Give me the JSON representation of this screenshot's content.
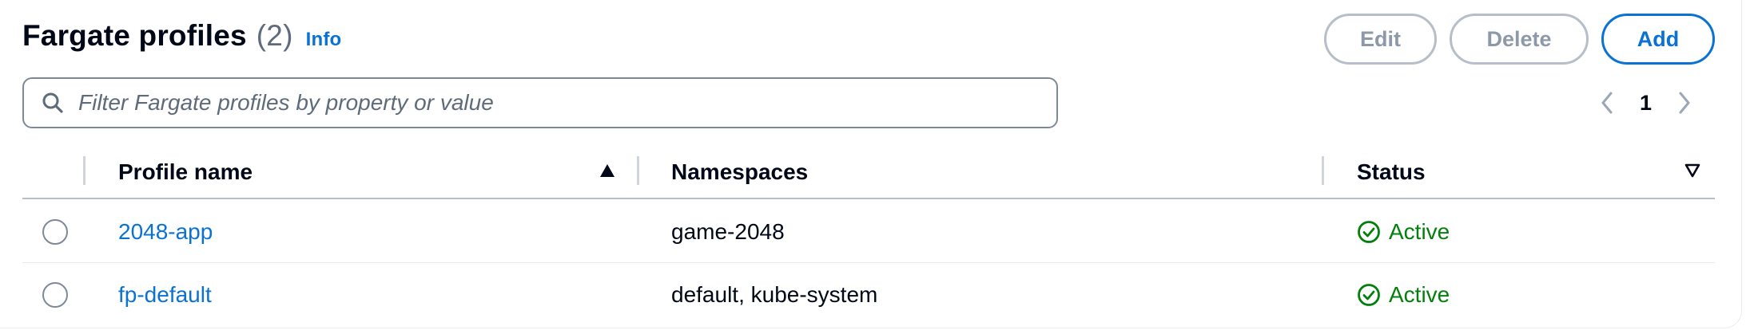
{
  "header": {
    "title": "Fargate profiles",
    "count": "(2)",
    "info_label": "Info"
  },
  "actions": {
    "edit_label": "Edit",
    "delete_label": "Delete",
    "add_label": "Add"
  },
  "search": {
    "placeholder": "Filter Fargate profiles by property or value"
  },
  "pagination": {
    "current_page": "1"
  },
  "table": {
    "columns": {
      "profile_name": "Profile name",
      "namespaces": "Namespaces",
      "status": "Status"
    },
    "sort": {
      "column": "Profile name",
      "direction": "ascending"
    },
    "rows": [
      {
        "profile_name": "2048-app",
        "namespaces": "game-2048",
        "status": "Active"
      },
      {
        "profile_name": "fp-default",
        "namespaces": "default, kube-system",
        "status": "Active"
      }
    ]
  },
  "colors": {
    "link": "#0972d3",
    "success": "#037f0c",
    "disabled_border": "#b6bec9"
  }
}
